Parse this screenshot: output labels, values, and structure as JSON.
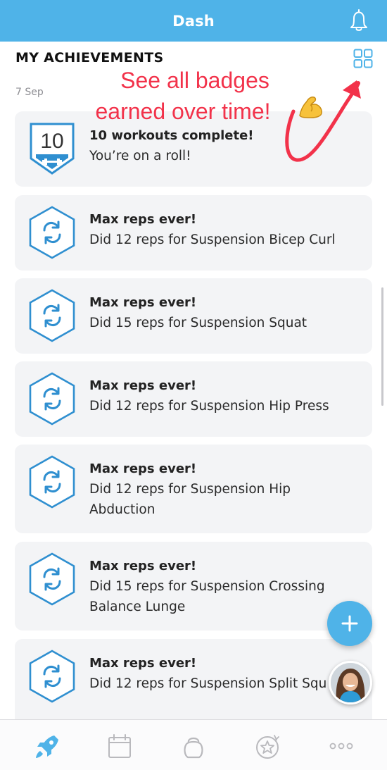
{
  "header": {
    "title": "Dash",
    "icon": "bell-icon"
  },
  "section": {
    "title": "MY ACHIEVEMENTS",
    "date": "7 Sep",
    "view_all_icon": "grid-icon"
  },
  "annotation": {
    "line1": "See all badges",
    "line2": "earned over time!",
    "emoji": "flexed-biceps",
    "color": "#f2324a"
  },
  "achievements": [
    {
      "badge_number": "10",
      "badge_icon": "dumbbell-icon",
      "title": "10 workouts complete!",
      "lines": [
        "You’re on a roll!"
      ]
    },
    {
      "badge_icon": "refresh-icon",
      "title": "Max reps ever!",
      "lines": [
        "Did 12 reps for Suspension Bicep Curl"
      ]
    },
    {
      "badge_icon": "refresh-icon",
      "title": "Max reps ever!",
      "lines": [
        "Did 15 reps for Suspension Squat"
      ]
    },
    {
      "badge_icon": "refresh-icon",
      "title": "Max reps ever!",
      "lines": [
        "Did 12 reps for Suspension Hip Press"
      ]
    },
    {
      "badge_icon": "refresh-icon",
      "title": "Max reps ever!",
      "lines": [
        "Did 12 reps for Suspension Hip",
        "Abduction"
      ]
    },
    {
      "badge_icon": "refresh-icon",
      "title": "Max reps ever!",
      "lines": [
        "Did 15 reps for Suspension Crossing",
        "Balance Lunge"
      ]
    },
    {
      "badge_icon": "refresh-icon",
      "title": "Max reps ever!",
      "lines": [
        "Did 12 reps for Suspension Split Squ"
      ]
    }
  ],
  "fab": {
    "icon": "plus-icon"
  },
  "coach": {
    "icon": "coach-avatar"
  },
  "tabs": [
    {
      "icon": "rocket-icon",
      "active": true
    },
    {
      "icon": "calendar-icon",
      "active": false
    },
    {
      "icon": "kettlebell-icon",
      "active": false
    },
    {
      "icon": "achievement-star-icon",
      "active": false
    },
    {
      "icon": "more-icon",
      "active": false
    }
  ],
  "colors": {
    "brand": "#4fb3e8",
    "card_bg": "#f3f4f6",
    "tab_inactive": "#b9b9bd"
  }
}
